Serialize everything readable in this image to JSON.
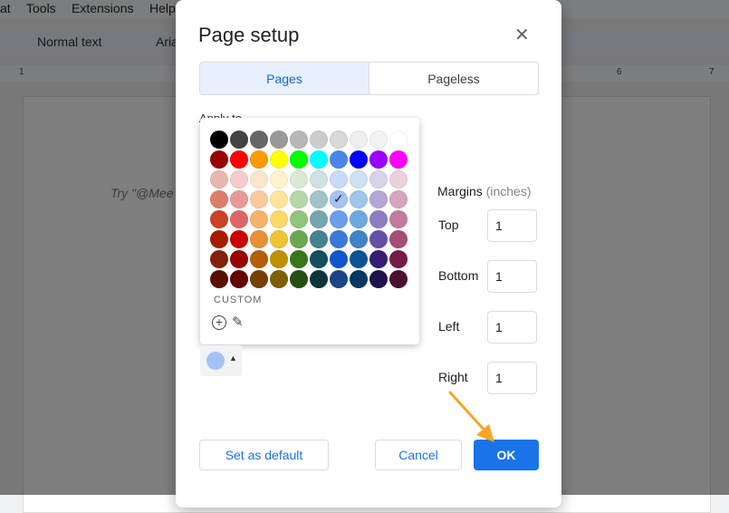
{
  "menu": [
    "at",
    "Tools",
    "Extensions",
    "Help"
  ],
  "toolbar": {
    "style": "Normal text",
    "font": "Aria"
  },
  "ruler": [
    "1",
    "6",
    "7"
  ],
  "doc": {
    "placeholder": "Try \"@Mee"
  },
  "dialog": {
    "title": "Page setup",
    "tabs": [
      {
        "label": "Pages",
        "active": true
      },
      {
        "label": "Pageless",
        "active": false
      }
    ],
    "apply_to_label": "Apply to",
    "margins_label": "Margins",
    "margins_unit": "(inches)",
    "margins": [
      {
        "label": "Top",
        "value": "1"
      },
      {
        "label": "Bottom",
        "value": "1"
      },
      {
        "label": "Left",
        "value": "1"
      },
      {
        "label": "Right",
        "value": "1"
      }
    ],
    "set_default_label": "Set as default",
    "cancel_label": "Cancel",
    "ok_label": "OK",
    "accent": "#1a73e8"
  },
  "palette": {
    "custom_label": "CUSTOM",
    "selected": "#a4c2f4",
    "rows": [
      [
        "#000000",
        "#434343",
        "#666666",
        "#999999",
        "#b7b7b7",
        "#cccccc",
        "#d9d9d9",
        "#efefef",
        "#f3f3f3",
        "#ffffff"
      ],
      [
        "#980000",
        "#ff0000",
        "#ff9900",
        "#ffff00",
        "#00ff00",
        "#00ffff",
        "#4a86e8",
        "#0000ff",
        "#9900ff",
        "#ff00ff"
      ],
      [
        "#e6b8af",
        "#f4cccc",
        "#fce5cd",
        "#fff2cc",
        "#d9ead3",
        "#d0e0e3",
        "#c9daf8",
        "#cfe2f3",
        "#d9d2e9",
        "#ead1dc"
      ],
      [
        "#dd7e6b",
        "#ea9999",
        "#f9cb9c",
        "#ffe599",
        "#b6d7a8",
        "#a2c4c9",
        "#a4c2f4",
        "#9fc5e8",
        "#b4a7d6",
        "#d5a6bd"
      ],
      [
        "#cc4125",
        "#e06666",
        "#f6b26b",
        "#ffd966",
        "#93c47d",
        "#76a5af",
        "#6d9eeb",
        "#6fa8dc",
        "#8e7cc3",
        "#c27ba0"
      ],
      [
        "#a61c00",
        "#cc0000",
        "#e69138",
        "#f1c232",
        "#6aa84f",
        "#45818e",
        "#3c78d8",
        "#3d85c6",
        "#674ea7",
        "#a64d79"
      ],
      [
        "#85200c",
        "#990000",
        "#b45f06",
        "#bf9000",
        "#38761d",
        "#134f5c",
        "#1155cc",
        "#0b5394",
        "#351c75",
        "#741b47"
      ],
      [
        "#5b0f00",
        "#660000",
        "#783f04",
        "#7f6000",
        "#274e13",
        "#0c343d",
        "#1c4587",
        "#073763",
        "#20124d",
        "#4c1130"
      ]
    ]
  }
}
